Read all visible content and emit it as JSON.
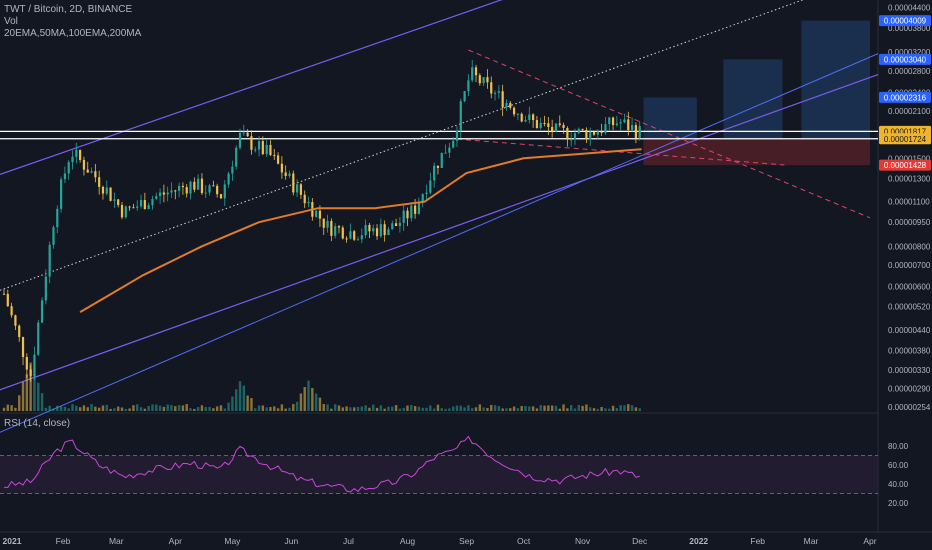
{
  "header": {
    "symbol_line": "TWT / Bitcoin, 2D, BINANCE",
    "vol_label": "Vol",
    "ma_label": "20EMA,50MA,100EMA,200MA"
  },
  "rsi_panel": {
    "label": "RSI (14, close)"
  },
  "colors": {
    "background": "#131722",
    "candle_up": "#26a69a",
    "candle_down": "#f0c04a",
    "ma_line": "#e07b2a",
    "channel": "#7b5cf0",
    "dashed_trend": "#e0436b",
    "rsi_line": "#c848d8",
    "rsi_band": "#2a2038",
    "target_box": "#1e3a5f",
    "stop_box": "#5a2028",
    "tag_blue": "#2962ff",
    "tag_orange": "#f0b429",
    "tag_red": "#e53935"
  },
  "chart_data": {
    "type": "candlestick",
    "scale": "log",
    "x_ticks": [
      "2021",
      "Feb",
      "Mar",
      "Apr",
      "May",
      "Jun",
      "Jul",
      "Aug",
      "Sep",
      "Oct",
      "Nov",
      "Dec",
      "2022",
      "Feb",
      "Mar",
      "Apr"
    ],
    "y_ticks": [
      "0.00004400",
      "0.00003800",
      "0.00003200",
      "0.00002800",
      "0.00002400",
      "0.00002100",
      "0.00001800",
      "0.00001500",
      "0.00001300",
      "0.00001100",
      "0.00000950",
      "0.00000800",
      "0.00000700",
      "0.00000600",
      "0.00000520",
      "0.00000440",
      "0.00000380",
      "0.00000330",
      "0.00000290",
      "0.00000254"
    ],
    "price_tags": [
      {
        "label": "0.00004009",
        "value": 4.009e-05,
        "style": "blue"
      },
      {
        "label": "0.00003040",
        "value": 3.04e-05,
        "style": "blue"
      },
      {
        "label": "0.00002316",
        "value": 2.316e-05,
        "style": "blue"
      },
      {
        "label": "0.00001817",
        "value": 1.817e-05,
        "style": "orange"
      },
      {
        "label": "0.00001724",
        "value": 1.724e-05,
        "style": "orange"
      },
      {
        "label": "0.00001428",
        "value": 1.428e-05,
        "style": "red"
      }
    ],
    "price_path": [
      {
        "date": "2021-01-01",
        "price": 5.7e-06
      },
      {
        "date": "2021-01-15",
        "price": 3.2e-06
      },
      {
        "date": "2021-01-28",
        "price": 1.05e-05
      },
      {
        "date": "2021-02-05",
        "price": 1.58e-05
      },
      {
        "date": "2021-02-20",
        "price": 1.28e-05
      },
      {
        "date": "2021-03-05",
        "price": 1.02e-05
      },
      {
        "date": "2021-03-20",
        "price": 1.13e-05
      },
      {
        "date": "2021-04-10",
        "price": 1.25e-05
      },
      {
        "date": "2021-04-25",
        "price": 1.15e-05
      },
      {
        "date": "2021-05-05",
        "price": 1.75e-05
      },
      {
        "date": "2021-05-20",
        "price": 1.55e-05
      },
      {
        "date": "2021-06-05",
        "price": 1.18e-05
      },
      {
        "date": "2021-06-20",
        "price": 9.2e-06
      },
      {
        "date": "2021-07-05",
        "price": 8.8e-06
      },
      {
        "date": "2021-07-25",
        "price": 9.2e-06
      },
      {
        "date": "2021-08-05",
        "price": 1.05e-05
      },
      {
        "date": "2021-08-15",
        "price": 1.4e-05
      },
      {
        "date": "2021-08-25",
        "price": 1.75e-05
      },
      {
        "date": "2021-09-03",
        "price": 2.75e-05
      },
      {
        "date": "2021-09-15",
        "price": 2.4e-05
      },
      {
        "date": "2021-09-28",
        "price": 2.1e-05
      },
      {
        "date": "2021-10-05",
        "price": 1.95e-05
      },
      {
        "date": "2021-10-20",
        "price": 1.8e-05
      },
      {
        "date": "2021-11-05",
        "price": 1.8e-05
      },
      {
        "date": "2021-11-20",
        "price": 1.95e-05
      },
      {
        "date": "2021-12-02",
        "price": 1.8e-05
      }
    ],
    "ma_path": [
      {
        "date": "2021-02-10",
        "price": 5e-06
      },
      {
        "date": "2021-03-15",
        "price": 6.5e-06
      },
      {
        "date": "2021-04-15",
        "price": 8e-06
      },
      {
        "date": "2021-05-15",
        "price": 9.5e-06
      },
      {
        "date": "2021-06-15",
        "price": 1.05e-05
      },
      {
        "date": "2021-07-15",
        "price": 1.05e-05
      },
      {
        "date": "2021-08-10",
        "price": 1.1e-05
      },
      {
        "date": "2021-09-01",
        "price": 1.35e-05
      },
      {
        "date": "2021-10-01",
        "price": 1.5e-05
      },
      {
        "date": "2021-11-01",
        "price": 1.55e-05
      },
      {
        "date": "2021-12-02",
        "price": 1.6e-05
      }
    ],
    "rsi_ticks": [
      "80.00",
      "60.00",
      "40.00",
      "20.00"
    ],
    "rsi_band": [
      30,
      70
    ],
    "rsi_path": [
      {
        "date": "2021-01-01",
        "value": 38
      },
      {
        "date": "2021-01-15",
        "value": 42
      },
      {
        "date": "2021-01-28",
        "value": 74
      },
      {
        "date": "2021-02-05",
        "value": 85
      },
      {
        "date": "2021-02-20",
        "value": 60
      },
      {
        "date": "2021-03-05",
        "value": 48
      },
      {
        "date": "2021-03-20",
        "value": 55
      },
      {
        "date": "2021-04-10",
        "value": 62
      },
      {
        "date": "2021-04-25",
        "value": 55
      },
      {
        "date": "2021-05-05",
        "value": 76
      },
      {
        "date": "2021-05-20",
        "value": 60
      },
      {
        "date": "2021-06-05",
        "value": 45
      },
      {
        "date": "2021-06-20",
        "value": 38
      },
      {
        "date": "2021-07-05",
        "value": 34
      },
      {
        "date": "2021-07-25",
        "value": 42
      },
      {
        "date": "2021-08-05",
        "value": 52
      },
      {
        "date": "2021-08-15",
        "value": 68
      },
      {
        "date": "2021-08-25",
        "value": 75
      },
      {
        "date": "2021-09-03",
        "value": 88
      },
      {
        "date": "2021-09-15",
        "value": 68
      },
      {
        "date": "2021-09-28",
        "value": 55
      },
      {
        "date": "2021-10-05",
        "value": 48
      },
      {
        "date": "2021-10-20",
        "value": 44
      },
      {
        "date": "2021-11-05",
        "value": 50
      },
      {
        "date": "2021-11-20",
        "value": 54
      },
      {
        "date": "2021-12-02",
        "value": 47
      }
    ],
    "volume_spikes": [
      {
        "date": "2021-01-15",
        "relative": 1.0
      },
      {
        "date": "2021-05-05",
        "relative": 0.55
      },
      {
        "date": "2021-06-10",
        "relative": 0.62
      }
    ],
    "projection_boxes": [
      {
        "from": "2021-12-03",
        "to": "2021-12-31",
        "top": 2.316e-05,
        "bottom": 1.724e-05,
        "kind": "target"
      },
      {
        "from": "2022-01-14",
        "to": "2022-02-14",
        "top": 3.04e-05,
        "bottom": 1.724e-05,
        "kind": "target"
      },
      {
        "from": "2022-02-24",
        "to": "2022-04-01",
        "top": 4.009e-05,
        "bottom": 1.724e-05,
        "kind": "target"
      },
      {
        "from": "2021-12-03",
        "to": "2022-04-01",
        "top": 1.724e-05,
        "bottom": 1.428e-05,
        "kind": "stop"
      }
    ],
    "horizontal_levels": [
      1.817e-05,
      1.724e-05
    ]
  }
}
